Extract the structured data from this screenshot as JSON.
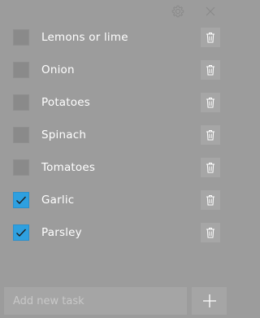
{
  "header": {
    "settings_icon": "gear-icon",
    "close_icon": "close-icon"
  },
  "tasks": [
    {
      "label": "Lemons or lime",
      "checked": false
    },
    {
      "label": "Onion",
      "checked": false
    },
    {
      "label": "Potatoes",
      "checked": false
    },
    {
      "label": "Spinach",
      "checked": false
    },
    {
      "label": "Tomatoes",
      "checked": false
    },
    {
      "label": "Garlic",
      "checked": true
    },
    {
      "label": "Parsley",
      "checked": true
    }
  ],
  "new_task": {
    "placeholder": "Add new task",
    "value": "",
    "add_icon": "plus-icon"
  },
  "colors": {
    "background": "#9c9c9c",
    "checked": "#2ea0e0",
    "text": "#ffffff"
  }
}
